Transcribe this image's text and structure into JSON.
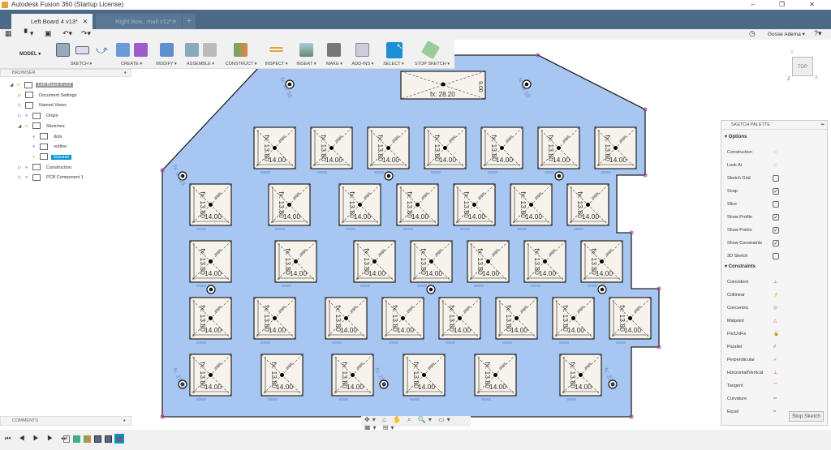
{
  "window": {
    "title": "Autodesk Fusion 360 (Startup License)",
    "controls": "– ❐ ✕"
  },
  "tabs": [
    {
      "label": "Left Board 4 v13*",
      "active": true
    },
    {
      "label": "Right Boa...mall v12*",
      "active": false
    }
  ],
  "new_tab": "+",
  "quickbar": {
    "grid": "▦",
    "file": "▘▾",
    "save": "▣",
    "undo": "↶▾",
    "redo": "↷▾"
  },
  "user": {
    "name": "Gosse Adema ▾",
    "clock": "◷",
    "help": "?▾"
  },
  "ribbon": {
    "workspace": "MODEL ▾",
    "groups": [
      "SKETCH ▾",
      "CREATE ▾",
      "MODIFY ▾",
      "ASSEMBLE ▾",
      "CONSTRUCT ▾",
      "INSPECT ▾",
      "INSERT ▾",
      "MAKE ▾",
      "ADD-INS ▾",
      "SELECT ▾",
      "STOP SKETCH ▾"
    ]
  },
  "browser": {
    "title": "BROWSER",
    "items": [
      "Left Board 4 v13",
      "Document Settings",
      "Named Views",
      "Origin",
      "Sketches",
      "dots",
      "outline",
      "topcase",
      "Construction",
      "PCB Component 1"
    ]
  },
  "comments": "COMMENTS",
  "viewcube": {
    "face": "TOP",
    "x": "X",
    "y": "Y",
    "z": "Z"
  },
  "palette": {
    "title": "SKETCH PALETTE",
    "options_header": "▾ Options",
    "options": [
      {
        "label": "Construction",
        "state": "icon"
      },
      {
        "label": "Look At",
        "state": "icon"
      },
      {
        "label": "Sketch Grid",
        "state": false
      },
      {
        "label": "Snap",
        "state": true
      },
      {
        "label": "Slice",
        "state": false
      },
      {
        "label": "Show Profile",
        "state": true
      },
      {
        "label": "Show Points",
        "state": true
      },
      {
        "label": "Show Constraints",
        "state": true
      },
      {
        "label": "3D Sketch",
        "state": false
      }
    ],
    "constraints_header": "▾ Constraints",
    "constraints": [
      "Coincident",
      "Collinear",
      "Concentric",
      "Midpoint",
      "Fix/UnFix",
      "Parallel",
      "Perpendicular",
      "Horizontal/Vertical",
      "Tangent",
      "Curvature",
      "Equal"
    ],
    "stop_button": "Stop Sketch"
  },
  "sketch": {
    "key_width_dim": "14.00",
    "key_height_dim": "13.80",
    "fx": "fx:",
    "top_box_dim": "28.20",
    "top_box_height": "9.00",
    "hole_dim": "22.55",
    "fill_color": "#a8c6f2",
    "key_fill": "#f8f3ea"
  },
  "navbar": "✥▾ ⌂ ✋ ⌕ 🔍▾ ▭▾ ▦▾ ⊞▾",
  "timeline": {
    "controls": "⏮ ◀ ▶ ▶ ⏭"
  }
}
